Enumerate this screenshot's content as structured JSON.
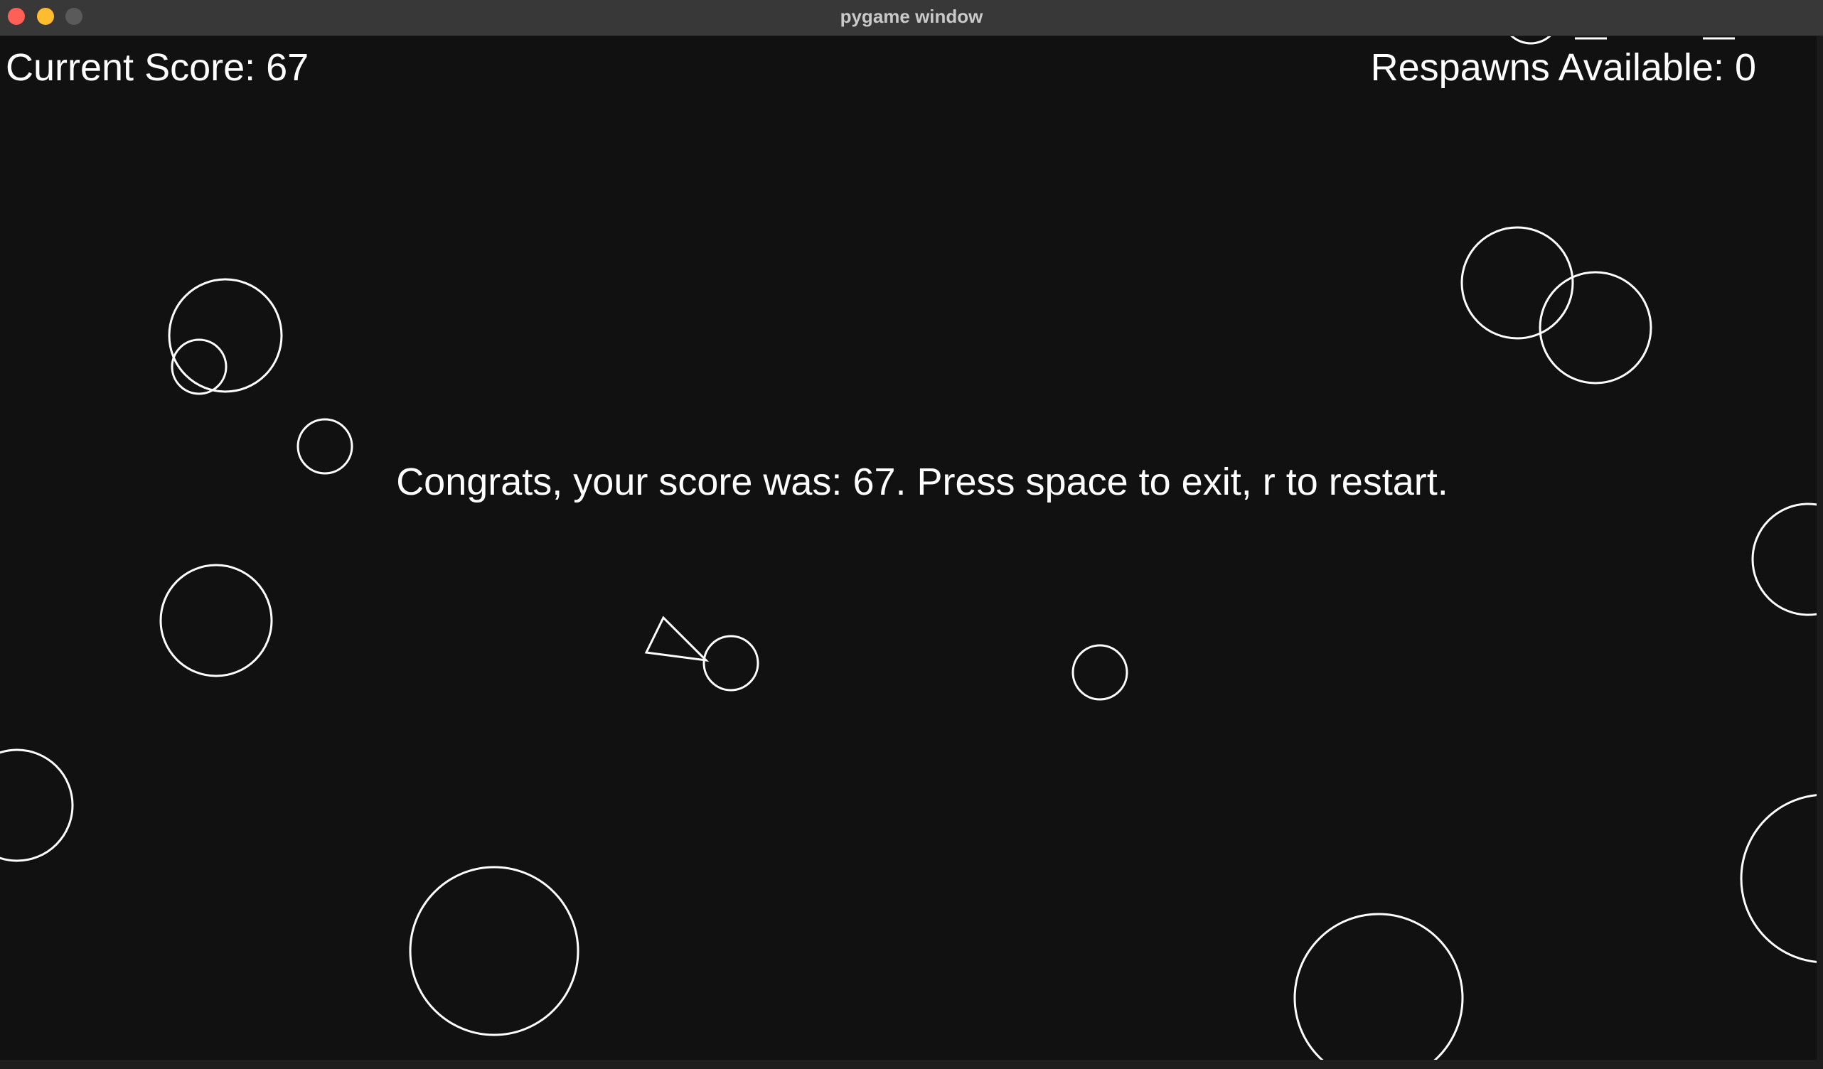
{
  "window": {
    "title": "pygame window",
    "controls": [
      "close-icon",
      "minimize-icon",
      "zoom-icon"
    ],
    "traffic_colors": {
      "close": "#fe5f57",
      "minimize": "#febc2e",
      "zoom": "#5a5a5a"
    }
  },
  "hud": {
    "score_text": "Current Score: 67",
    "respawns_text": "Respawns Available: 0"
  },
  "game_over": {
    "message": "Congrats, your score was: 67. Press space to exit, r to restart."
  },
  "colors": {
    "background": "#111111",
    "foreground": "#ffffff"
  },
  "entities": {
    "ship": "triangle-outline",
    "asteroid_count": 18
  }
}
